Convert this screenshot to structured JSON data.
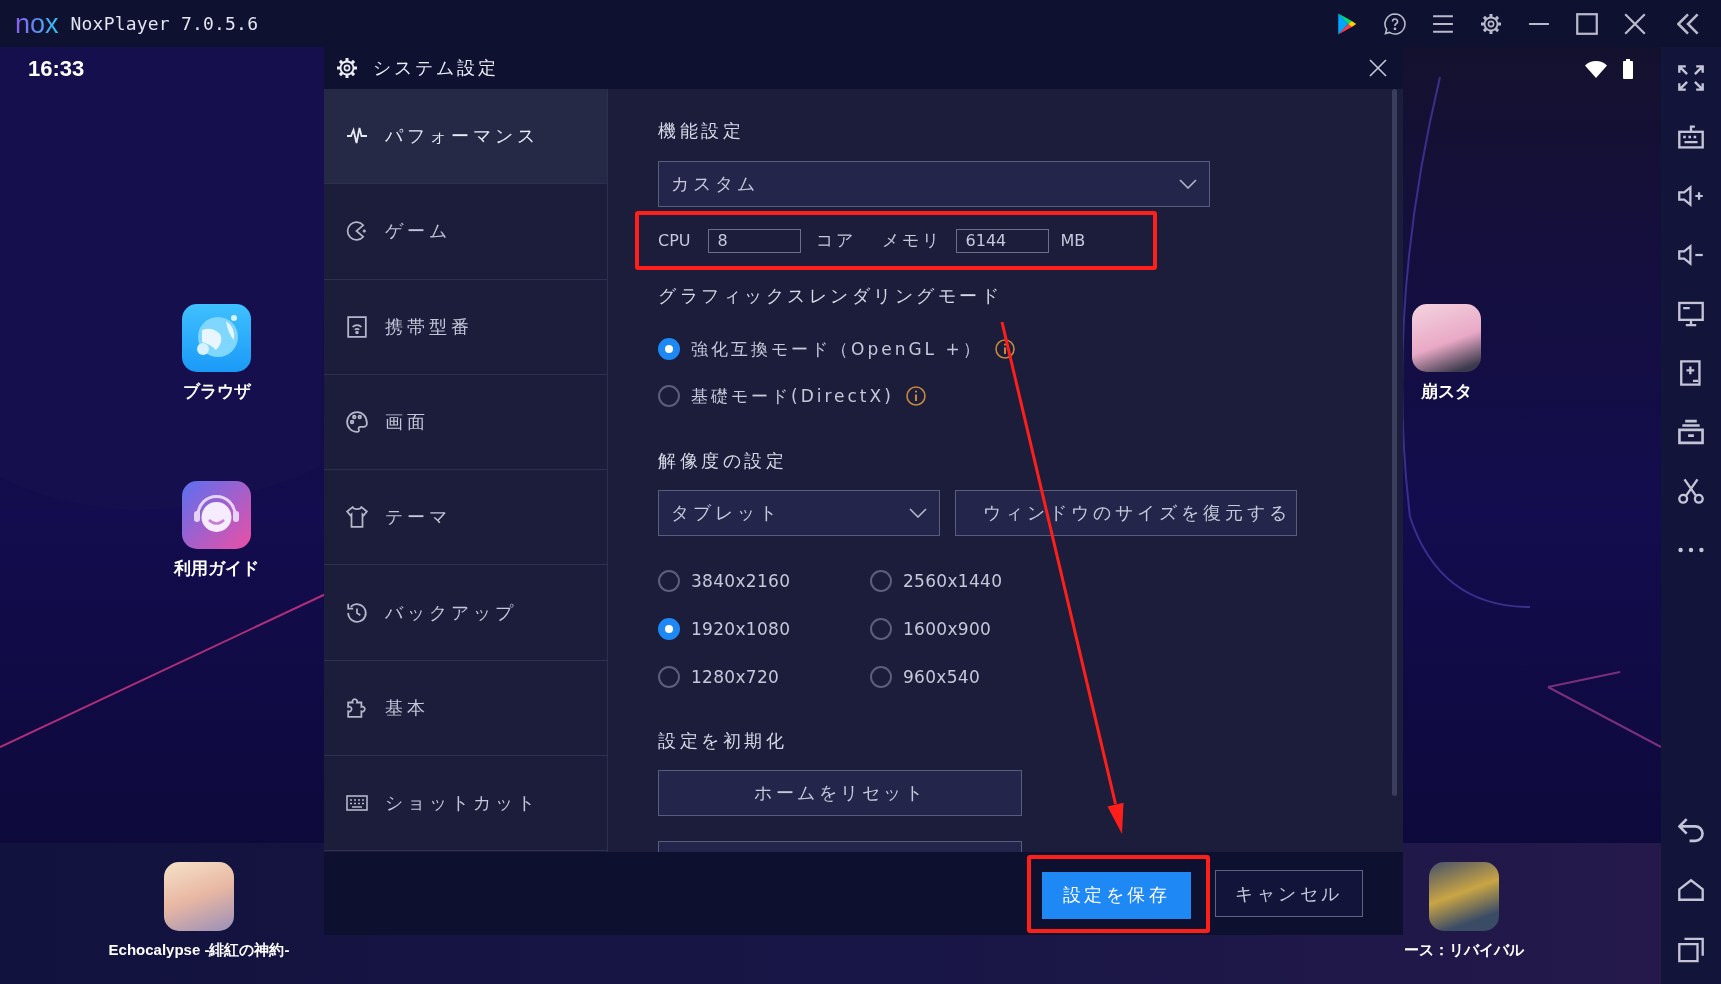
{
  "title_bar": {
    "logo": "nox",
    "app_name": "NoxPlayer 7.0.5.6"
  },
  "status_bar": {
    "time": "16:33"
  },
  "home_apps": [
    {
      "label": "ブラウザ",
      "kind": "browser"
    },
    {
      "label": "利用ガイド",
      "kind": "guide"
    },
    {
      "label": "崩スタ",
      "kind": "game"
    }
  ],
  "dock_apps": [
    {
      "label": "Echocalypse -緋紅の神約-"
    },
    {
      "label": "ース：リバイバル"
    }
  ],
  "settings_dialog": {
    "title": "システム設定",
    "nav": [
      {
        "label": "パフォーマンス",
        "kind": "pulse",
        "selected": true
      },
      {
        "label": "ゲーム",
        "kind": "game",
        "selected": false
      },
      {
        "label": "携帯型番",
        "kind": "phone",
        "selected": false
      },
      {
        "label": "画面",
        "kind": "palette",
        "selected": false
      },
      {
        "label": "テーマ",
        "kind": "shirt",
        "selected": false
      },
      {
        "label": "バックアップ",
        "kind": "history",
        "selected": false
      },
      {
        "label": "基本",
        "kind": "puzzle",
        "selected": false
      },
      {
        "label": "ショットカット",
        "kind": "keyboard",
        "selected": false
      }
    ],
    "performance": {
      "heading": "機能設定",
      "preset": "カスタム",
      "resources": {
        "highlighted": true,
        "cpu_label": "CPU",
        "cpu_value": "8",
        "cpu_unit": "コア",
        "memory_label": "メモリ",
        "memory_value": "6144",
        "memory_unit": "MB"
      }
    },
    "graphics": {
      "heading": "グラフィックスレンダリングモード",
      "options": [
        {
          "label": "強化互換モード（OpenGL +）",
          "selected": true,
          "info": true
        },
        {
          "label": "基礎モード(DirectX)",
          "selected": false,
          "info": true
        }
      ]
    },
    "resolution": {
      "heading": "解像度の設定",
      "device": "タブレット",
      "restore_button": "ウィンドウのサイズを復元する",
      "options": [
        {
          "label": "3840x2160",
          "selected": false
        },
        {
          "label": "2560x1440",
          "selected": false
        },
        {
          "label": "1920x1080",
          "selected": true
        },
        {
          "label": "1600x900",
          "selected": false
        },
        {
          "label": "1280x720",
          "selected": false
        },
        {
          "label": "960x540",
          "selected": false
        }
      ]
    },
    "reset": {
      "heading": "設定を初期化",
      "buttons": [
        "ホームをリセット"
      ],
      "partially_hidden_button": true
    },
    "footer": {
      "save": {
        "label": "設定を保存",
        "highlighted": true
      },
      "cancel": "キャンセル"
    }
  },
  "pointer_arrow": true
}
